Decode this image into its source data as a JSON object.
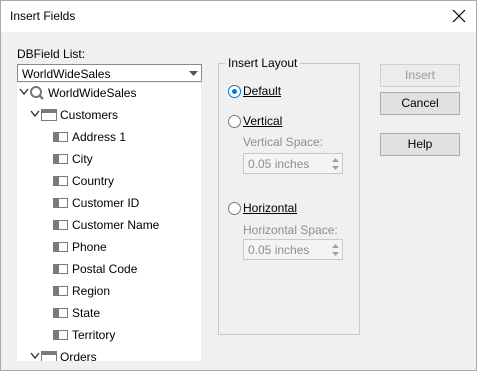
{
  "window": {
    "title": "Insert Fields"
  },
  "dbfield": {
    "label": "DBField List:",
    "selected": "WorldWideSales"
  },
  "tree": {
    "root": "WorldWideSales",
    "table": "Customers",
    "fields": [
      "Address 1",
      "City",
      "Country",
      "Customer ID",
      "Customer Name",
      "Phone",
      "Postal Code",
      "Region",
      "State",
      "Territory"
    ],
    "next_table": "Orders"
  },
  "layout": {
    "group_title": "Insert Layout",
    "default_label": "Default",
    "vertical_label": "Vertical",
    "vertical_space_label": "Vertical Space:",
    "vertical_space_value": "0.05 inches",
    "horizontal_label": "Horizontal",
    "horizontal_space_label": "Horizontal Space:",
    "horizontal_space_value": "0.05 inches",
    "selected": "Default"
  },
  "buttons": {
    "insert": "Insert",
    "cancel": "Cancel",
    "help": "Help"
  },
  "icons": [
    "close-icon",
    "chevron-down-icon",
    "database-icon",
    "table-icon",
    "field-icon",
    "scroll-up-icon",
    "scroll-down-icon"
  ]
}
